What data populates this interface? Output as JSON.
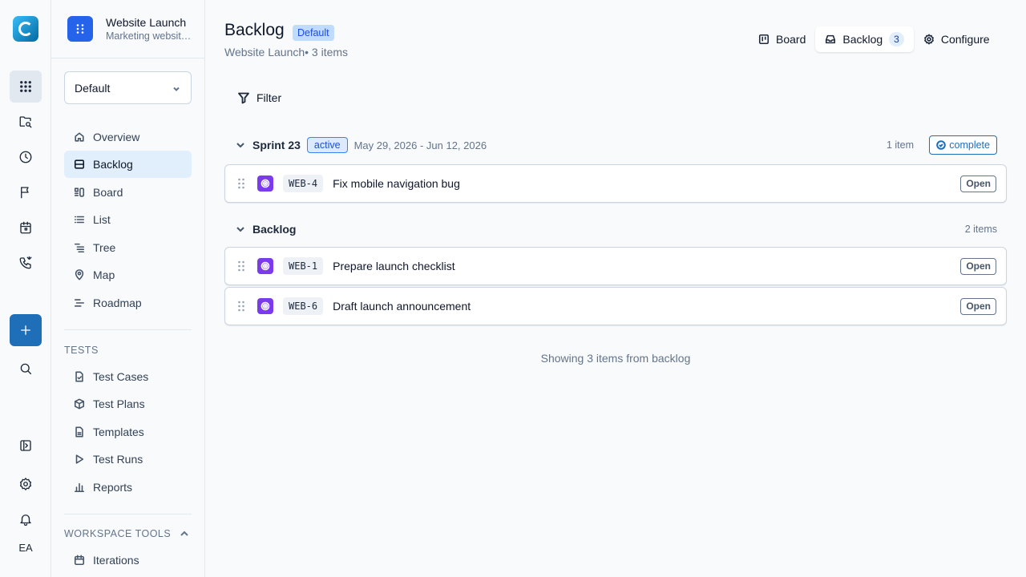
{
  "rail": {
    "items": [
      {
        "icon": "apps-grid-icon"
      },
      {
        "icon": "folder-search-icon"
      },
      {
        "icon": "clock-icon"
      },
      {
        "icon": "flag-icon"
      },
      {
        "icon": "calendar-icon"
      },
      {
        "icon": "phone-icon"
      },
      {
        "icon": "plus-icon"
      },
      {
        "icon": "search-icon"
      },
      {
        "icon": "sidebar-toggle-icon"
      },
      {
        "icon": "settings-icon"
      },
      {
        "icon": "bell-icon"
      }
    ],
    "user_initials": "EA"
  },
  "project": {
    "name": "Website Launch",
    "subtitle": "Marketing website launch"
  },
  "view_select": {
    "value": "Default"
  },
  "nav": {
    "items": [
      {
        "label": "Overview",
        "icon": "home-icon"
      },
      {
        "label": "Backlog",
        "icon": "backlog-icon",
        "active": true
      },
      {
        "label": "Board",
        "icon": "board-icon"
      },
      {
        "label": "List",
        "icon": "list-icon"
      },
      {
        "label": "Tree",
        "icon": "tree-icon"
      },
      {
        "label": "Map",
        "icon": "map-pin-icon"
      },
      {
        "label": "Roadmap",
        "icon": "roadmap-icon"
      }
    ]
  },
  "tests": {
    "label": "TESTS",
    "items": [
      {
        "label": "Test Cases",
        "icon": "file-check-icon"
      },
      {
        "label": "Test Plans",
        "icon": "package-icon"
      },
      {
        "label": "Templates",
        "icon": "file-icon"
      },
      {
        "label": "Test Runs",
        "icon": "play-icon"
      },
      {
        "label": "Reports",
        "icon": "bar-chart-icon"
      }
    ]
  },
  "workspace_tools": {
    "label": "WORKSPACE TOOLS",
    "items": [
      {
        "label": "Iterations",
        "icon": "calendar-icon"
      }
    ]
  },
  "header": {
    "title": "Backlog",
    "badge": "Default",
    "subtitle": "Website Launch• 3 items"
  },
  "tabs": [
    {
      "label": "Board",
      "icon": "board-icon"
    },
    {
      "label": "Backlog",
      "icon": "inbox-icon",
      "count": "3",
      "active": true
    },
    {
      "label": "Configure",
      "icon": "gear-icon"
    }
  ],
  "filter": {
    "label": "Filter"
  },
  "sprint": {
    "title": "Sprint 23",
    "status": "active",
    "dates": "May 29, 2026 - Jun 12, 2026",
    "count": "1 item",
    "complete_label": "complete",
    "items": [
      {
        "key": "WEB-4",
        "title": "Fix mobile navigation bug",
        "status": "Open"
      }
    ]
  },
  "backlog": {
    "title": "Backlog",
    "count": "2 items",
    "items": [
      {
        "key": "WEB-1",
        "title": "Prepare launch checklist",
        "status": "Open"
      },
      {
        "key": "WEB-6",
        "title": "Draft launch announcement",
        "status": "Open"
      }
    ]
  },
  "footer": {
    "text": "Showing 3 items from backlog"
  },
  "colors": {
    "accent": "#1f6fb8",
    "project_icon": "#2563eb",
    "issue_type": "#7c3aed",
    "active_nav": "#e0effb"
  }
}
